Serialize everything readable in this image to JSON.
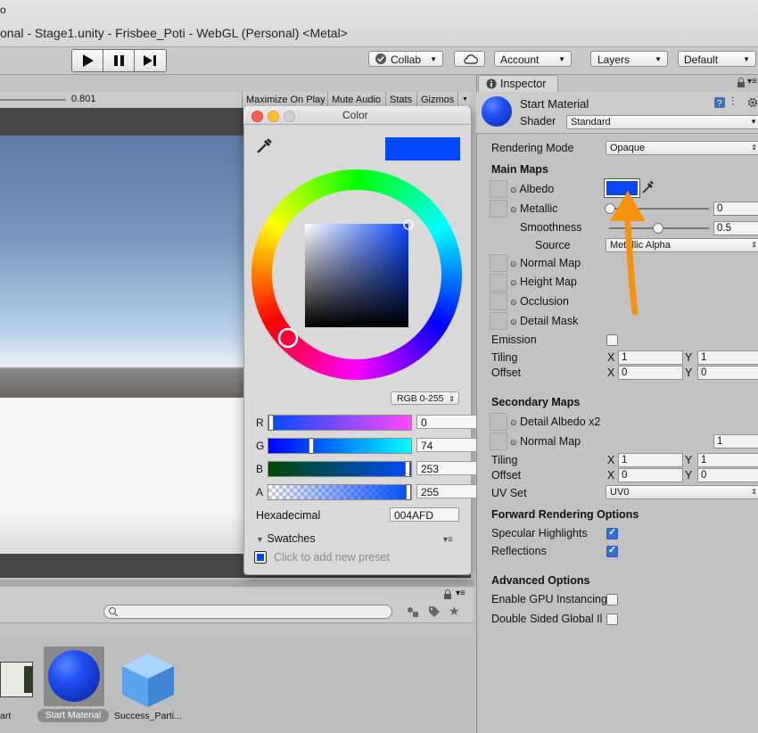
{
  "app": {
    "menu_fragment": "o",
    "title": "onal - Stage1.unity - Frisbee_Poti - WebGL (Personal) <Metal>"
  },
  "toolbar": {
    "collab": "Collab",
    "account": "Account",
    "layers": "Layers",
    "layout": "Default"
  },
  "game_view": {
    "scale_value": "0.801",
    "tabs": [
      "Maximize On Play",
      "Mute Audio",
      "Stats",
      "Gizmos"
    ]
  },
  "color_picker": {
    "title": "Color",
    "color_hex_display": "#004AFD",
    "mode": "RGB 0-255",
    "channels": [
      {
        "label": "R",
        "value": "0"
      },
      {
        "label": "G",
        "value": "74"
      },
      {
        "label": "B",
        "value": "253"
      },
      {
        "label": "A",
        "value": "255"
      }
    ],
    "channel_levels": {
      "R": 0,
      "G": 74,
      "B": 253,
      "A": 255
    },
    "hex_label": "Hexadecimal",
    "hex_value": "004AFD",
    "swatches_label": "Swatches",
    "add_preset": "Click to add new preset"
  },
  "project": {
    "assets": [
      {
        "label": "art"
      },
      {
        "label": "Start Material"
      },
      {
        "label": "Success_Parti..."
      }
    ]
  },
  "inspector": {
    "tab": "Inspector",
    "material_name": "Start Material",
    "shader_label": "Shader",
    "shader_value": "Standard",
    "rendering_mode_label": "Rendering Mode",
    "rendering_mode_value": "Opaque",
    "main_maps_header": "Main Maps",
    "albedo": "Albedo",
    "metallic": "Metallic",
    "metallic_value": "0",
    "smoothness": "Smoothness",
    "smoothness_value": "0.5",
    "source": "Source",
    "source_value": "Metallic Alpha",
    "normal_map": "Normal Map",
    "height_map": "Height Map",
    "occlusion": "Occlusion",
    "detail_mask": "Detail Mask",
    "emission": "Emission",
    "tiling": "Tiling",
    "offset": "Offset",
    "x": "X",
    "y": "Y",
    "tiling_x": "1",
    "tiling_y": "1",
    "offset_x": "0",
    "offset_y": "0",
    "secondary_maps_header": "Secondary Maps",
    "detail_albedo": "Detail Albedo x2",
    "secondary_normal_map": "Normal Map",
    "secondary_normal_value": "1",
    "sec_tiling_x": "1",
    "sec_tiling_y": "1",
    "sec_offset_x": "0",
    "sec_offset_y": "0",
    "uv_set": "UV Set",
    "uv_set_value": "UV0",
    "forward_header": "Forward Rendering Options",
    "specular_highlights": "Specular Highlights",
    "reflections": "Reflections",
    "advanced_header": "Advanced Options",
    "gpu_instancing": "Enable GPU Instancing",
    "double_sided": "Double Sided Global Il"
  },
  "colors": {
    "albedo": "#0a47f5",
    "annotation_arrow": "#f7930a"
  }
}
